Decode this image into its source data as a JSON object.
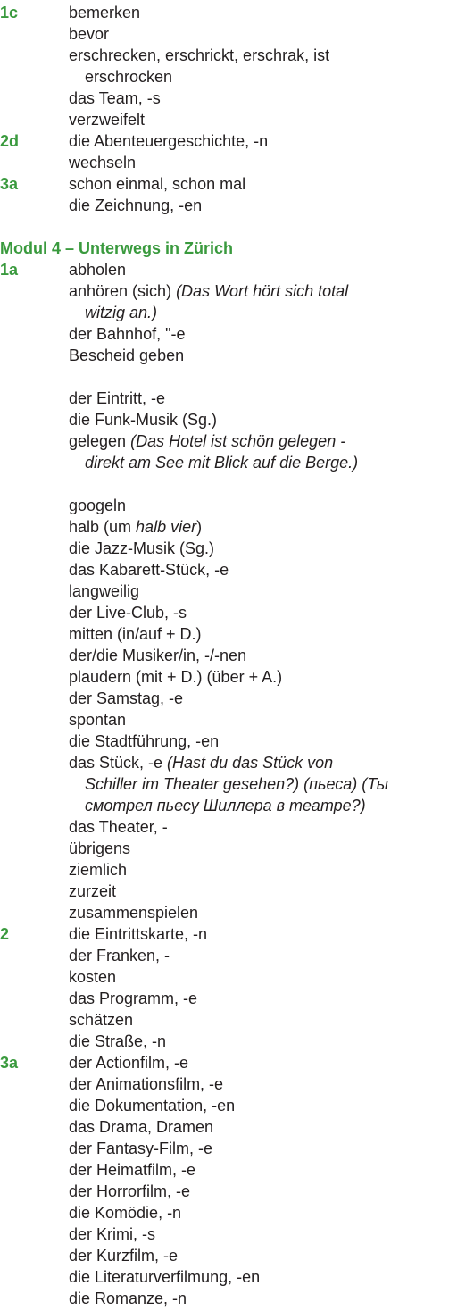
{
  "lines": [
    {
      "label": "1c",
      "text": "bemerken"
    },
    {
      "text": "bevor"
    },
    {
      "text": "erschrecken, erschrickt, erschrak, ist"
    },
    {
      "text": "erschrocken",
      "cont": true
    },
    {
      "text": "das Team, -s"
    },
    {
      "text": "verzweifelt"
    },
    {
      "label": "2d",
      "text": "die Abenteuergeschichte, -n"
    },
    {
      "text": "wechseln"
    },
    {
      "label": "3a",
      "text": "schon einmal, schon mal"
    },
    {
      "text": "die Zeichnung, -en"
    },
    {
      "blank": true
    },
    {
      "heading": "Modul 4 – Unterwegs in Zürich"
    },
    {
      "label": "1a",
      "text": "abholen"
    },
    {
      "text": "anhören (sich)",
      "italic": " (Das Wort hört sich total"
    },
    {
      "italic": "witzig an.)",
      "cont": true
    },
    {
      "text": "der Bahnhof, \"-e"
    },
    {
      "text": "Bescheid geben"
    },
    {
      "blank": true
    },
    {
      "text": "der Eintritt, -e"
    },
    {
      "text": "die Funk-Musik (Sg.)"
    },
    {
      "text": "gelegen",
      "italic": " (Das Hotel ist schön gelegen -"
    },
    {
      "italic": "direkt am See mit Blick auf die Berge.)",
      "cont": true
    },
    {
      "blank": true
    },
    {
      "text": "googeln"
    },
    {
      "text": "halb (um ",
      "italic": "halb vier",
      "after": ")"
    },
    {
      "text": "die Jazz-Musik (Sg.)"
    },
    {
      "text": "das Kabarett-Stück, -e"
    },
    {
      "text": "langweilig"
    },
    {
      "text": "der Live-Club, -s"
    },
    {
      "text": "mitten (in/auf + D.)"
    },
    {
      "text": "der/die Musiker/in, -/-nen"
    },
    {
      "text": "plaudern (mit + D.) (über + A.)"
    },
    {
      "text": "der Samstag, -e"
    },
    {
      "text": "spontan"
    },
    {
      "text": "die Stadtführung, -en"
    },
    {
      "text": "das Stück, -e",
      "italic": " (Hast du das Stück von"
    },
    {
      "italic": "Schiller im Theater gesehen?) (пьеса) (Ты",
      "cont": true
    },
    {
      "italic": "смотрел пьесу Шиллера в театре?)",
      "cont": true
    },
    {
      "text": "das Theater, -"
    },
    {
      "text": "übrigens"
    },
    {
      "text": "ziemlich"
    },
    {
      "text": "zurzeit"
    },
    {
      "text": "zusammenspielen"
    },
    {
      "label": "2",
      "text": "die Eintrittskarte, -n"
    },
    {
      "text": "der Franken, -"
    },
    {
      "text": "kosten"
    },
    {
      "text": "das Programm, -e"
    },
    {
      "text": "schätzen"
    },
    {
      "text": "die Straße, -n"
    },
    {
      "label": "3a",
      "text": "der Actionfilm, -e"
    },
    {
      "text": "der Animationsfilm, -e"
    },
    {
      "text": "die Dokumentation, -en"
    },
    {
      "text": "das Drama, Dramen"
    },
    {
      "text": "der Fantasy-Film, -e"
    },
    {
      "text": "der Heimatfilm, -e"
    },
    {
      "text": "der Horrorfilm, -e"
    },
    {
      "text": "die Komödie, -n"
    },
    {
      "text": "der Krimi, -s"
    },
    {
      "text": "der Kurzfilm, -e"
    },
    {
      "text": "die Literaturverfilmung, -en"
    },
    {
      "text": "die Romanze, -n"
    }
  ]
}
